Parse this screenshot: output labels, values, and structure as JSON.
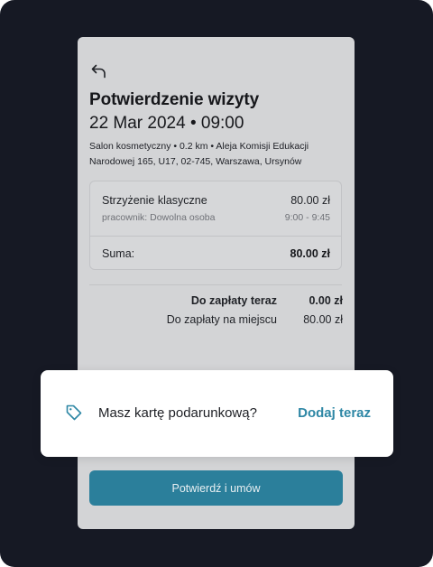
{
  "visit": {
    "title": "Potwierdzenie wizyty",
    "datetime": "22 Mar 2024 • 09:00",
    "address": "Salon kosmetyczny • 0.2 km • Aleja Komisji Edukacji Narodowej 165, U17, 02-745, Warszawa, Ursynów"
  },
  "service": {
    "name": "Strzyżenie klasyczne",
    "price": "80.00 zł",
    "worker": "pracownik: Dowolna osoba",
    "time": "9:00 - 9:45"
  },
  "summary": {
    "label": "Suma:",
    "value": "80.00 zł"
  },
  "payment": {
    "now_label": "Do zapłaty teraz",
    "now_value": "0.00 zł",
    "later_label": "Do zapłaty na miejscu",
    "later_value": "80.00 zł"
  },
  "confirm_button": "Potwierdź i umów",
  "gift_card": {
    "icon": "tag-icon",
    "question": "Masz kartę podarunkową?",
    "action": "Dodaj teraz"
  },
  "colors": {
    "accent": "#2b7f9b",
    "link": "#2e87a5",
    "backdrop": "#161924"
  }
}
